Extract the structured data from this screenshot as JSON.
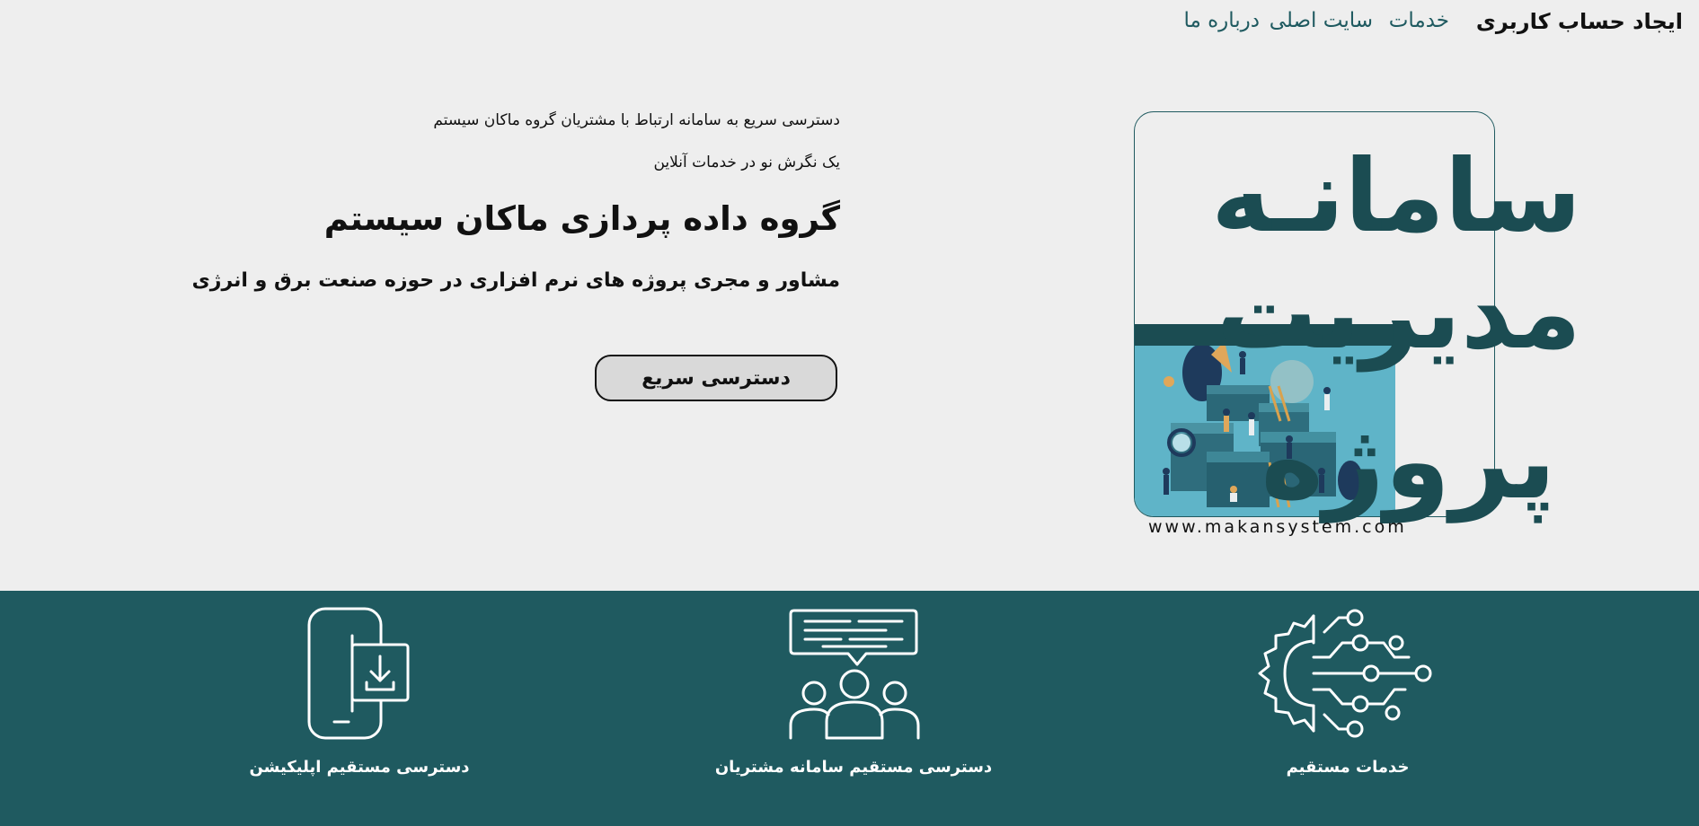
{
  "header": {
    "brand": "ایجاد حساب کاربری",
    "nav": {
      "services": "خدمات",
      "main_site": "سایت اصلی",
      "about": "درباره ما"
    }
  },
  "hero": {
    "tagline1": "دسترسی سریع به سامانه ارتباط با مشتریان گروه ماکان سیستم",
    "tagline2": "یک نگرش نو در خدمات آنلاین",
    "company": "گروه داده پردازی ماکان سیستم",
    "subtitle": "مشاور و مجری پروژه های نرم افزاری در حوزه صنعت برق و انرژی",
    "cta": "دسترسی سریع"
  },
  "logo": {
    "line1": "سامانـه",
    "line2": "مدیریت",
    "line3": "پروژه",
    "url": "www.makansystem.com"
  },
  "features": [
    {
      "label": "دسترسی مستقیم اپلیکیشن",
      "icon": "mobile-download-icon"
    },
    {
      "label": "دسترسی مستقیم سامانه مشتریان",
      "icon": "customers-chat-icon"
    },
    {
      "label": "خدمات مستقیم",
      "icon": "gear-circuit-icon"
    }
  ],
  "colors": {
    "band": "#1f5a60",
    "logo_teal": "#1b4c52",
    "background": "#eeeeee"
  }
}
